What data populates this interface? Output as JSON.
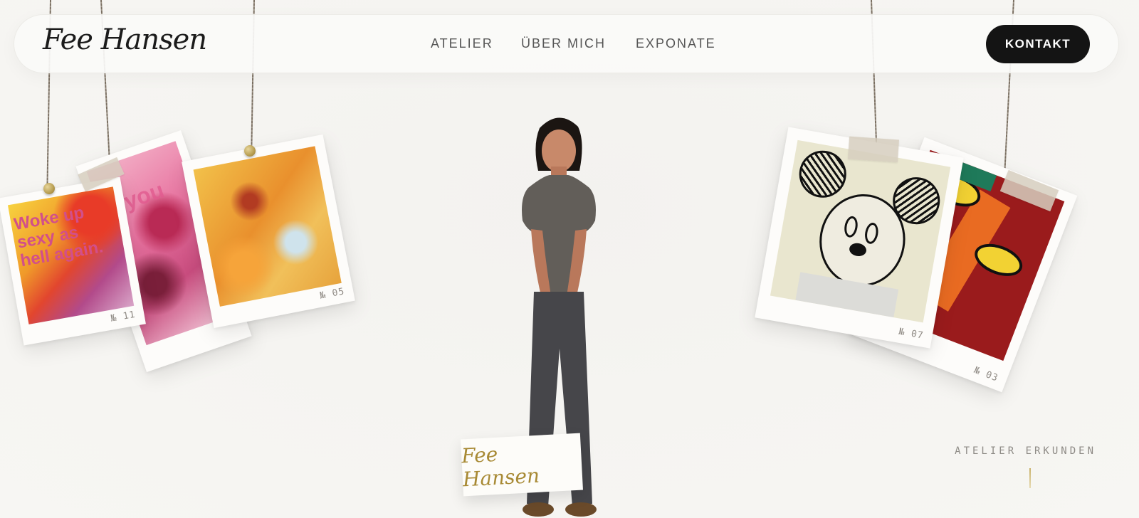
{
  "brand": {
    "logo_text": "Fee Hansen"
  },
  "nav": {
    "items": [
      {
        "label": "ATELIER"
      },
      {
        "label": "ÜBER MICH"
      },
      {
        "label": "EXPONATE"
      }
    ]
  },
  "cta": {
    "label": "KONTAKT"
  },
  "gallery": {
    "left": [
      {
        "number": "№ 11",
        "art_text": "Woke up sexy as hell again."
      },
      {
        "number": "",
        "art_text": "k you"
      },
      {
        "number": "№ 05",
        "art_text": ""
      }
    ],
    "right": [
      {
        "number": "№ 07",
        "art_text": ""
      },
      {
        "number": "№ 03",
        "art_text": ""
      }
    ]
  },
  "namecard": {
    "text": "Fee Hansen"
  },
  "explore": {
    "label": "ATELIER ERKUNDEN"
  },
  "colors": {
    "accent": "#b79d50",
    "dark": "#141414",
    "background": "#f5f4f1"
  }
}
